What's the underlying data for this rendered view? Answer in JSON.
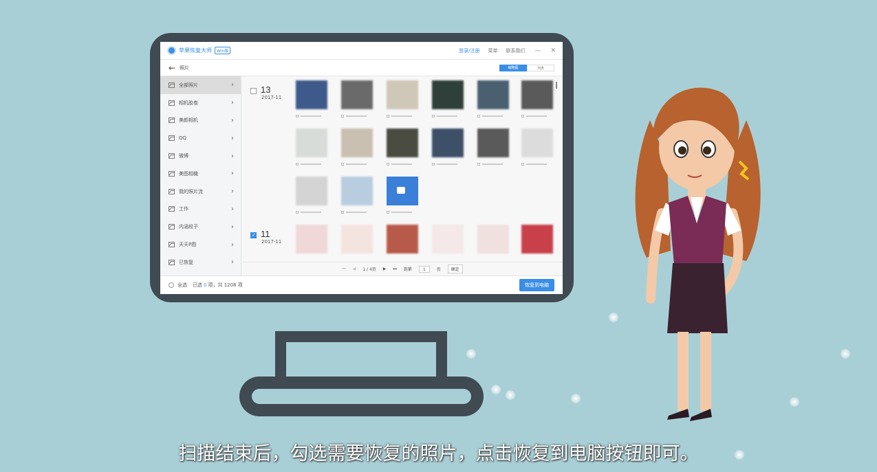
{
  "app": {
    "title": "苹果恢复大师",
    "edition": "Win版",
    "account_link": "登录/注册",
    "menu": "菜单",
    "contact": "联系我们",
    "minimize": "—",
    "close": "✕"
  },
  "subbar": {
    "title": "照片",
    "toggle_on": "缩略图",
    "toggle_off": "列表"
  },
  "sidebar": {
    "items": [
      {
        "label": "全部照片",
        "active": true
      },
      {
        "label": "相机胶卷"
      },
      {
        "label": "美颜相机"
      },
      {
        "label": "QQ"
      },
      {
        "label": "微博"
      },
      {
        "label": "美图相機"
      },
      {
        "label": "我的照片流"
      },
      {
        "label": "工作"
      },
      {
        "label": "内涵段子"
      },
      {
        "label": "天天P图"
      },
      {
        "label": "已恢复"
      }
    ]
  },
  "groups": [
    {
      "day": "13",
      "month": "2017-11",
      "checked": false
    },
    {
      "day": "11",
      "month": "2017-11",
      "checked": true
    }
  ],
  "pager": {
    "page": "1 / 4页",
    "goto_label": "到第",
    "goto_value": "1",
    "page_unit": "页",
    "confirm": "确定"
  },
  "footer": {
    "select_all": "全选",
    "selected_prefix": "已选",
    "selected_count": "0",
    "selected_suffix": "项，共 1208 项",
    "recover_button": "恢复到电脑"
  },
  "subtitle": "扫描结束后，勾选需要恢复的照片，点击恢复到电脑按钮即可。",
  "colors": {
    "background": "#a9cfd6",
    "accent": "#3a8ee6",
    "monitor": "#3f4a52"
  }
}
